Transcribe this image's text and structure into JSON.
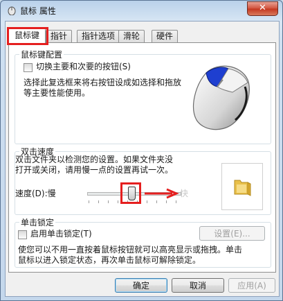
{
  "window": {
    "title": "鼠标 属性",
    "close_label": "✕"
  },
  "tabs": [
    {
      "label": "鼠标键",
      "active": true
    },
    {
      "label": "指针",
      "active": false
    },
    {
      "label": "指针选项",
      "active": false
    },
    {
      "label": "滑轮",
      "active": false
    },
    {
      "label": "硬件",
      "active": false
    }
  ],
  "button_config": {
    "group_label": "鼠标键配置",
    "swap_checkbox_label": "切换主要和次要的按钮(S)",
    "swap_checked": false,
    "description": [
      "选择此复选框来将右按钮设成如选择和拖放",
      "等主要性能使用。"
    ]
  },
  "double_click": {
    "group_label": "双击速度",
    "description": [
      "双击文件夹以检测您的设置。如果文件夹没",
      "打开或关闭，请用慢一点的设置再试一次。"
    ],
    "speed_label": "速度(D):慢",
    "fast_label": "快",
    "speed_level": 0.5
  },
  "click_lock": {
    "group_label": "单击锁定",
    "checkbox_label": "启用单击锁定(T)",
    "checked": false,
    "settings_button": "设置(E)...",
    "description": [
      "使您可以不用一直按着鼠标按钮就可以高亮显示或拖拽。单击",
      "鼠标以进入锁定状态，再次单击鼠标可解除锁定。"
    ]
  },
  "footer": {
    "ok": "确定",
    "cancel": "取消",
    "apply": "应用(A)"
  },
  "colors": {
    "highlight": "#e51f1f",
    "mouse_accent": "#1e3fd0"
  }
}
